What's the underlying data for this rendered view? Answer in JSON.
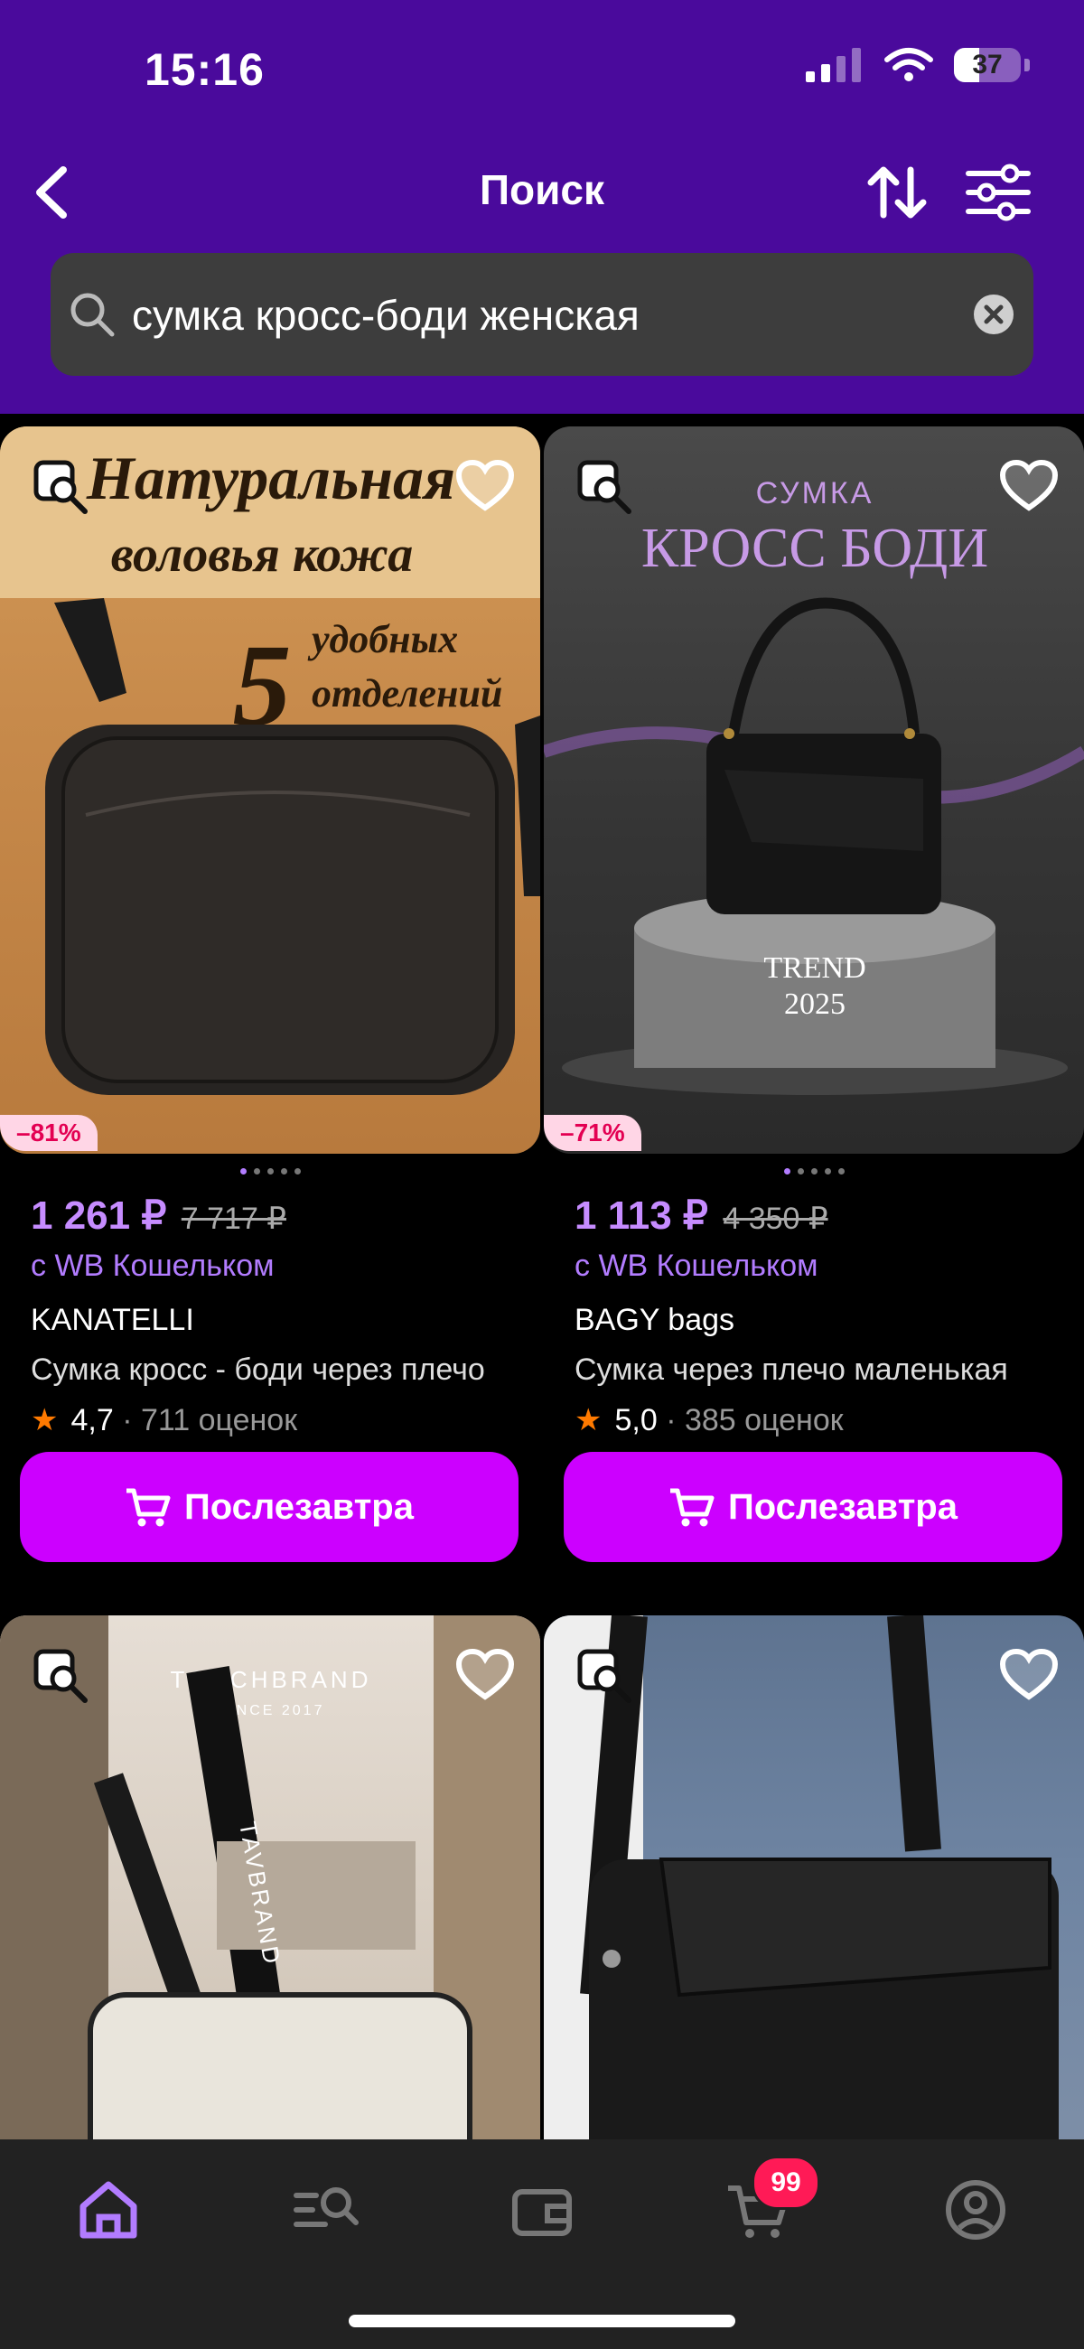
{
  "status": {
    "time": "15:16",
    "battery": "37"
  },
  "nav": {
    "title": "Поиск"
  },
  "search": {
    "query": "сумка кросс-боди женская"
  },
  "products": [
    {
      "discount": "–81%",
      "price": "1 261 ₽",
      "old_price": "7 717 ₽",
      "wallet_label": "с WB Кошельком",
      "brand": "KANATELLI",
      "name": "Сумка кросс - боди через плечо",
      "rating": "4,7",
      "reviews": "· 711 оценок",
      "buy_label": "Послезавтра",
      "image": {
        "line1": "Натуральная",
        "line2": "воловья кожа",
        "line3": "5",
        "line4": "удобных",
        "line5": "отделений"
      }
    },
    {
      "discount": "–71%",
      "price": "1 113 ₽",
      "old_price": "4 350 ₽",
      "wallet_label": "с WB Кошельком",
      "brand": "BAGY bags",
      "name": "Сумка через плечо маленькая",
      "rating": "5,0",
      "reviews": "· 385 оценок",
      "buy_label": "Послезавтра",
      "image": {
        "line1": "СУМКА",
        "line2": "КРОСС БОДИ",
        "line3": "TREND",
        "line4": "2025"
      }
    },
    {
      "image": {
        "line1": "TOUCHBRAND",
        "line2": "SINCE 2017",
        "strap": "TAVBRAND"
      }
    },
    {
      "image": {}
    }
  ],
  "tabbar": {
    "cart_count": "99"
  },
  "colors": {
    "header": "#4a0a9c",
    "accent": "#cc00ff",
    "price": "#c68cff",
    "badge": "#ff1a56"
  },
  "icons": [
    "back-arrow-icon",
    "sort-icon",
    "filter-icon",
    "search-icon",
    "clear-icon",
    "image-search-icon",
    "heart-icon",
    "cart-icon",
    "home-icon",
    "catalog-search-icon",
    "wallet-icon",
    "profile-icon"
  ]
}
